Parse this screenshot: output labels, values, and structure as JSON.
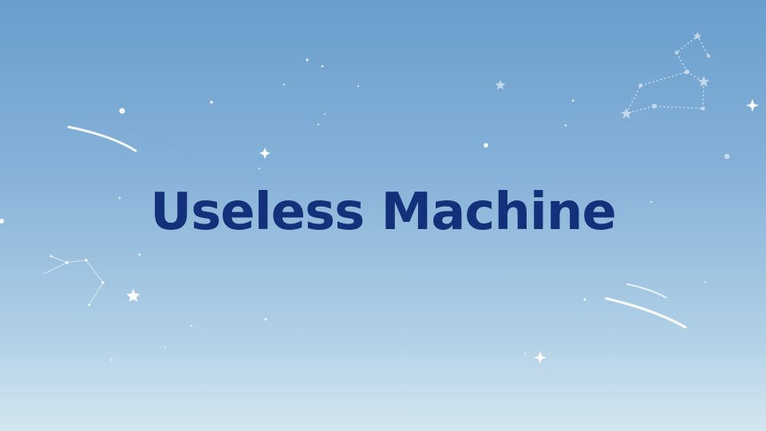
{
  "slide": {
    "title": "Useless Machine",
    "colors": {
      "title": "#13307a",
      "sky_top": "#6a9ecd",
      "sky_bottom": "#d3e6f0"
    },
    "decorations": [
      "stars",
      "shooting-stars",
      "constellations"
    ]
  }
}
